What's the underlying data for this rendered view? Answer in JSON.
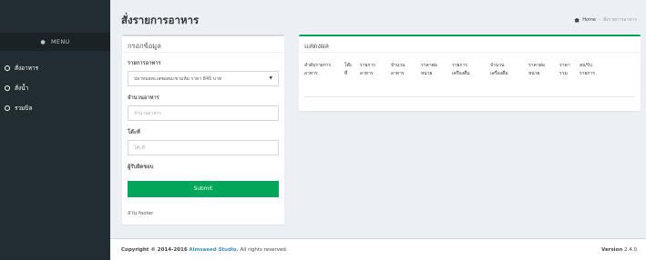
{
  "sidebar": {
    "menu_label": "MENU",
    "items": [
      {
        "label": "สั่งอาหาร"
      },
      {
        "label": "สั่งน้ำ"
      },
      {
        "label": "รวมบิล"
      }
    ]
  },
  "header": {
    "title": "สั่งรายการอาหาร",
    "breadcrumb_home": "Home",
    "breadcrumb_current": "สั่งรายการอาหาร"
  },
  "form": {
    "title": "กรอกข้อมูล",
    "food_label": "รายการอาหาร",
    "food_selected": "ปลาหมอทะเลซอสมะขามห้ม ราคา 845 บาท",
    "qty_label": "จำนวนอาหาร",
    "qty_placeholder": "จำนวนอาหาร",
    "table_label": "โต๊ะที่",
    "table_placeholder": "โต๊ะที่",
    "responsible_label": "ผู้รับผิดชอบ",
    "submit_label": "Submit",
    "footer_text": "ส่วน footer"
  },
  "results": {
    "title": "แสดงผล",
    "columns": [
      [
        "ลำดับรายการ",
        "อาหาร"
      ],
      [
        "โต๊ะ",
        "ที่"
      ],
      [
        "รายการ",
        "อาหาร"
      ],
      [
        "จำนวน",
        "อาหาร"
      ],
      [
        "ราคาต่อ",
        "หน่วย"
      ],
      [
        "รายการ",
        "เครื่องดื่ม"
      ],
      [
        "จำนวน",
        "เครื่องดื่ม"
      ],
      [
        "ราคาต่อ",
        "หน่วย"
      ],
      [
        "ราคา",
        "รวม"
      ],
      [
        "ลบ/รับ",
        "รายการ"
      ]
    ]
  },
  "footer": {
    "copyright_prefix": "Copyright © 2014-2016",
    "brand": "Almsaeed Studio.",
    "rights": "All rights reserved.",
    "version_label": "Version",
    "version": "2.4.0"
  },
  "colors": {
    "sidebar_bg": "#222d32",
    "accent_green": "#00a65a",
    "link_blue": "#3c8dbc"
  }
}
